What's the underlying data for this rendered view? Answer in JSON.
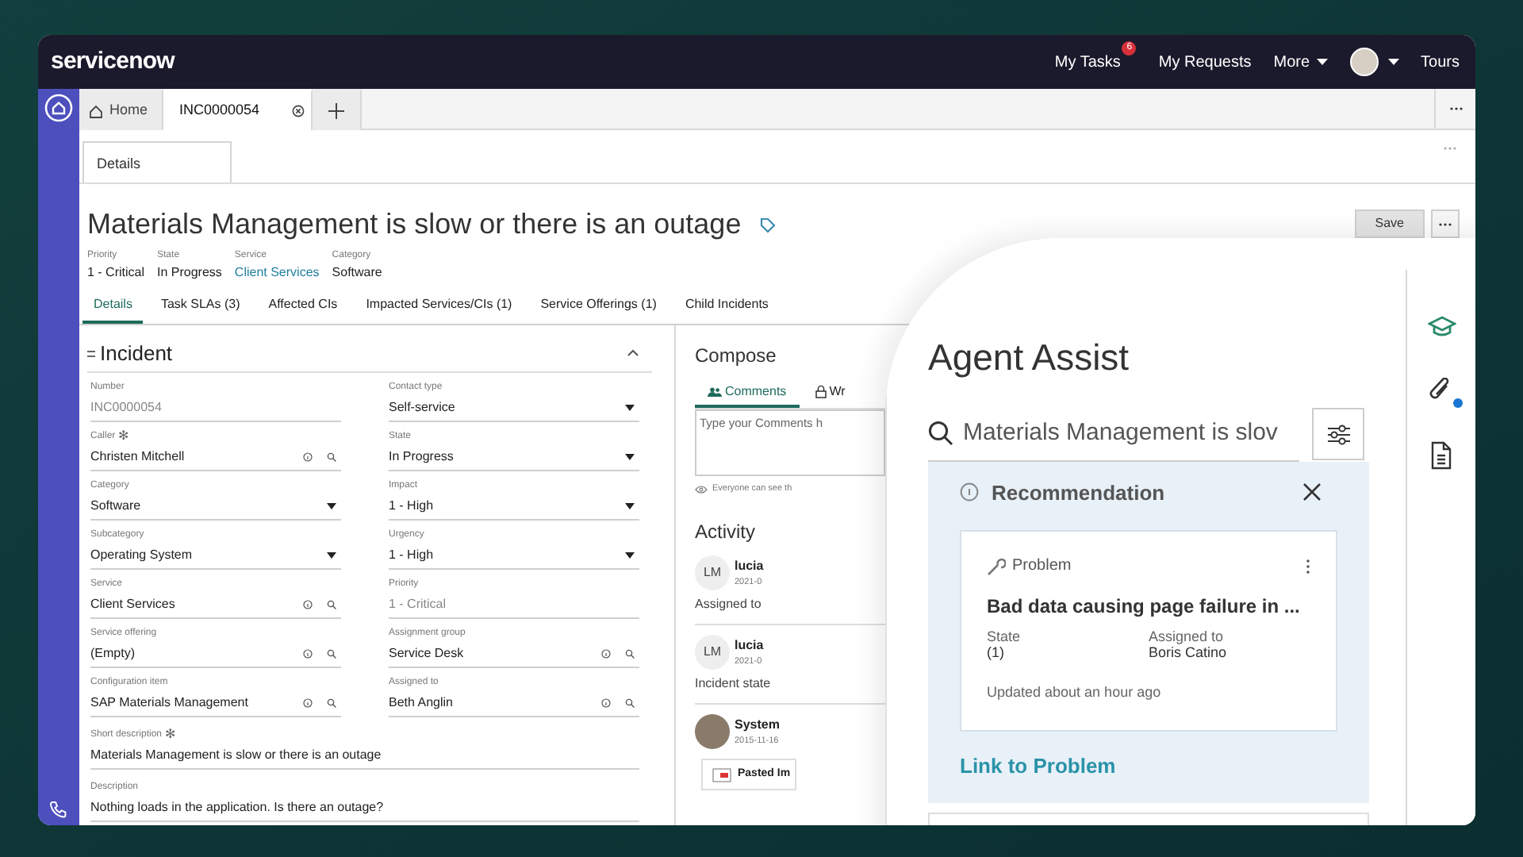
{
  "header": {
    "logo": "servicenow",
    "nav": [
      {
        "label": "My Tasks",
        "badge": "6",
        "kind": "badge"
      },
      {
        "label": "My Requests",
        "kind": "plain"
      },
      {
        "label": "More",
        "kind": "menu"
      },
      {
        "kind": "avatar"
      },
      {
        "label": "Tours",
        "kind": "plain"
      }
    ]
  },
  "tabs": [
    {
      "label": "Home",
      "kind": "home",
      "selected": false
    },
    {
      "label": "INC0000054",
      "kind": "record",
      "selected": true
    },
    {
      "kind": "add",
      "selected": false
    }
  ],
  "form_tab": "Details",
  "record": {
    "title": "Materials Management is slow or there is an outage",
    "meta": [
      {
        "label": "Priority",
        "value": "1 - Critical",
        "kind": "text"
      },
      {
        "label": "State",
        "value": "In Progress",
        "kind": "text"
      },
      {
        "label": "Service",
        "value": "Client Services",
        "kind": "link"
      },
      {
        "label": "Category",
        "value": "Software",
        "kind": "text"
      }
    ],
    "save": "Save"
  },
  "record_tabs": [
    {
      "label": "Details",
      "selected": true
    },
    {
      "label": "Task SLAs (3)",
      "selected": false
    },
    {
      "label": "Affected CIs",
      "selected": false
    },
    {
      "label": "Impacted Services/CIs (1)",
      "selected": false
    },
    {
      "label": "Service Offerings (1)",
      "selected": false
    },
    {
      "label": "Child Incidents",
      "selected": false
    }
  ],
  "section": {
    "title": "Incident",
    "expanded": true
  },
  "fields": [
    {
      "label": "Number",
      "value": "INC0000054",
      "kind": "readonly"
    },
    {
      "label": "Contact type",
      "value": "Self-service",
      "kind": "select"
    },
    {
      "label": "Caller",
      "required_mark": "✻",
      "value": "Christen Mitchell",
      "kind": "reference"
    },
    {
      "label": "State",
      "value": "In Progress",
      "kind": "select"
    },
    {
      "label": "Category",
      "value": "Software",
      "kind": "select"
    },
    {
      "label": "Impact",
      "value": "1 - High",
      "kind": "select"
    },
    {
      "label": "Subcategory",
      "value": "Operating System",
      "kind": "select"
    },
    {
      "label": "Urgency",
      "value": "1 - High",
      "kind": "select"
    },
    {
      "label": "Service",
      "value": "Client Services",
      "kind": "reference"
    },
    {
      "label": "Priority",
      "value": "1 - Critical",
      "kind": "readonly"
    },
    {
      "label": "Service offering",
      "value": "(Empty)",
      "kind": "reference"
    },
    {
      "label": "Assignment group",
      "value": "Service Desk",
      "kind": "reference"
    },
    {
      "label": "Configuration item",
      "value": "SAP Materials Management",
      "kind": "reference"
    },
    {
      "label": "Assigned to",
      "value": "Beth Anglin",
      "kind": "reference"
    }
  ],
  "wide_fields": [
    {
      "label": "Short description",
      "required_mark": "✻",
      "value": "Materials Management is slow or there is an outage"
    },
    {
      "label": "Description",
      "value": "Nothing loads in the application. Is there an outage?"
    }
  ],
  "compose": {
    "title": "Compose",
    "tabs": [
      {
        "label": "Comments",
        "kind": "people",
        "selected": true
      },
      {
        "label": "Wr",
        "kind": "lock",
        "selected": false
      }
    ],
    "placeholder": "Type your Comments h",
    "note": "Everyone can see th"
  },
  "activity": {
    "title": "Activity",
    "entries": [
      {
        "kind": "initials",
        "initials": "LM",
        "name": "lucia",
        "date": "2021-0",
        "text": "Assigned to"
      },
      {
        "kind": "initials",
        "initials": "LM",
        "name": "lucia",
        "date": "2021-0",
        "text": "Incident state"
      },
      {
        "kind": "photo",
        "name": "System",
        "date": "2015-11-16",
        "attachment": "Pasted Im"
      }
    ]
  },
  "agent_assist": {
    "title": "Agent Assist",
    "search": "Materials Management is slov",
    "recommendation": {
      "title": "Recommendation",
      "card": {
        "type": "Problem",
        "title": "Bad data causing page failure in ...",
        "fields": [
          {
            "label": "State",
            "value": "(1)"
          },
          {
            "label": "Assigned to",
            "value": "Boris Catino"
          }
        ],
        "updated": "Updated about an hour ago"
      },
      "link": "Link to Problem"
    }
  },
  "side_icons": [
    {
      "kind": "learn",
      "dot": false
    },
    {
      "kind": "attach",
      "dot": true
    },
    {
      "kind": "document",
      "dot": false
    }
  ]
}
